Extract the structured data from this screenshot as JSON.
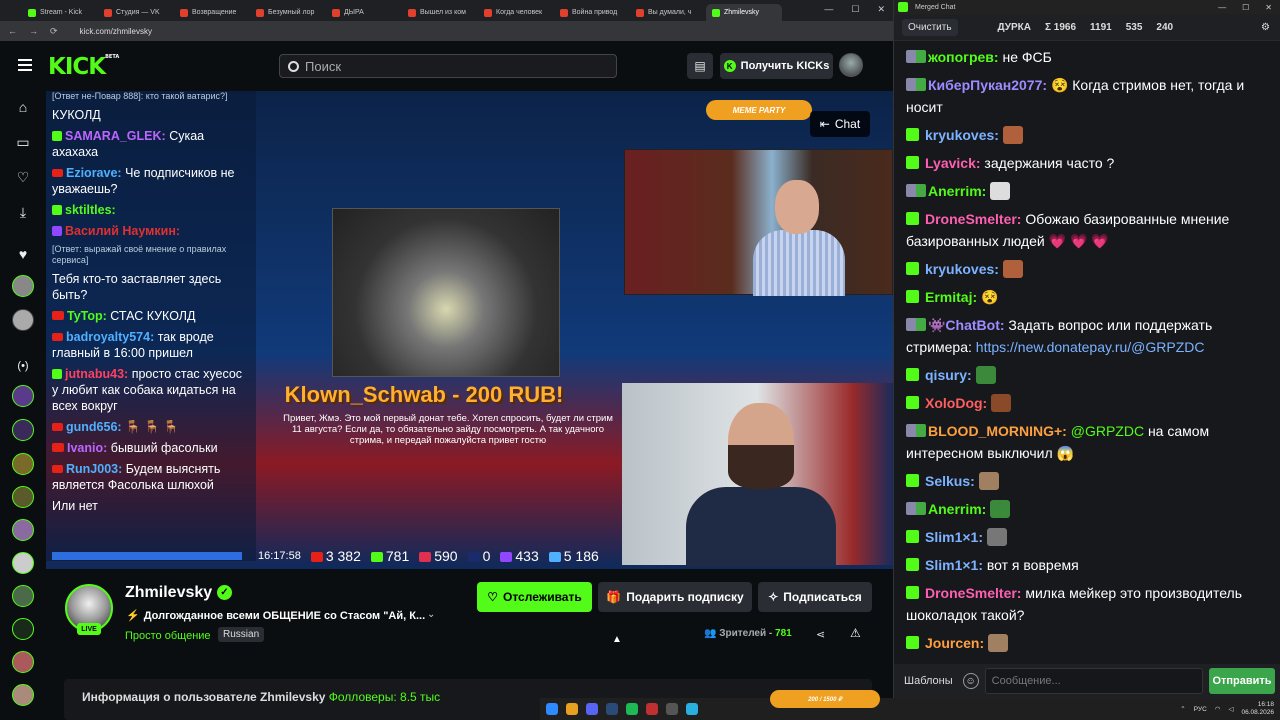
{
  "browser": {
    "tabs": [
      "Stream - Kick",
      "Студия — VK",
      "Возвращение",
      "Безумный лор",
      "ДЫРА",
      "Вышел из ком",
      "Когда человек",
      "Война привод",
      "Вы думали, ч",
      "Zhmilevsky"
    ],
    "url": "kick.com/zhmilevsky"
  },
  "header": {
    "logo": "KICK",
    "beta": "BETA",
    "search_placeholder": "Поиск",
    "kicks_button": "Получить KICKs"
  },
  "player": {
    "overlay_chat": [
      {
        "platform": "sub",
        "text": "[Ответ не-Повар 888]: кто такой ватарис?]"
      },
      {
        "platform": "none",
        "name": "",
        "text": "КУКОЛД"
      },
      {
        "platform": "kick",
        "name": "SAMARA_GLEK:",
        "text": "Сукаа ахахаха",
        "color": "#bb66ff"
      },
      {
        "platform": "yt",
        "name": "Eziorave:",
        "text": "Че подписчиков не уважаешь?",
        "color": "#4fb0ff"
      },
      {
        "platform": "kick",
        "name": "sktiltles:",
        "text": "",
        "color": "#53fc18"
      },
      {
        "platform": "tw",
        "name": "Василий Наумкин:",
        "text": "",
        "color": "#e03030"
      },
      {
        "platform": "sub",
        "text": "[Ответ: выражай своё мнение о правилах сервиса]"
      },
      {
        "platform": "none",
        "name": "",
        "text": "Тебя кто-то заставляет здесь быть?"
      },
      {
        "platform": "live",
        "name": "TyTop:",
        "text": "СТАС КУКОЛД",
        "color": "#53fc18"
      },
      {
        "platform": "yt",
        "name": "badroyalty574:",
        "text": "так вроде главный в 16:00 пришел",
        "color": "#4fb0ff"
      },
      {
        "platform": "kick",
        "name": "jutnabu43:",
        "text": "просто стас хуесос у любит как собака кидаться на всех вокруг",
        "color": "#ff4060"
      },
      {
        "platform": "yt",
        "name": "gund656:",
        "text": "🪑 🪑 🪑",
        "color": "#4fb0ff"
      },
      {
        "platform": "live",
        "name": "Ivanio:",
        "text": "бывший фасольки",
        "color": "#bb66ff"
      },
      {
        "platform": "yt",
        "name": "RunJ003:",
        "text": "Будем выяснять является Фасолька шлюхой",
        "color": "#4fb0ff"
      },
      {
        "platform": "none",
        "name": "",
        "text": "Или нет"
      }
    ],
    "donation_title": "Klown_Schwab - 200 RUB!",
    "donation_text": "Привет, Жмэ. Это мой первый донат тебе. Хотел спросить, будет ли стрим 11 августа? Если да, то обязательно зайду посмотреть. А так удачного стрима, и передай пожалуйста привет гостю",
    "meme_party": "MEME PARTY",
    "chat_toggle": "Chat",
    "stats": {
      "time": "16:17:58",
      "youtube": "3 382",
      "kick": "781",
      "vklive": "590",
      "rutube": "0",
      "twitch": "433",
      "total": "5 186"
    }
  },
  "channel": {
    "name": "Zhmilevsky",
    "live": "LIVE",
    "title": "Долгожданное всеми ОБЩЕНИЕ со Стасом \"Ай, К...",
    "category": "Просто общение",
    "language": "Russian",
    "follow": "Отслеживать",
    "gift": "Подарить подписку",
    "subscribe": "Подписаться",
    "viewers_label": "Зрителей -",
    "viewers_count": "781",
    "about_label": "Информация о пользователе Zhmilevsky",
    "followers_label": "Фолловеры:",
    "followers_count": "8.5 тыс"
  },
  "chatwin": {
    "title": "Merged Chat",
    "clear": "Очистить",
    "stats": [
      "ДУРКА",
      "Σ 1966",
      "1191",
      "535",
      "240"
    ],
    "messages": [
      {
        "src": "both",
        "user": "жопогрев:",
        "text": "не ФСБ",
        "color": "#53fc18"
      },
      {
        "src": "both",
        "user": "КиберПукан2077:",
        "text": "😵 Когда стримов нет, тогда и носит",
        "color": "#9f8bff"
      },
      {
        "src": "kick",
        "user": "kryukoves:",
        "text": "",
        "emote": "#b0603a",
        "color": "#7cb2ff"
      },
      {
        "src": "kick",
        "user": "Lyavick:",
        "text": "задержания часто ?",
        "color": "#ff5fb0"
      },
      {
        "src": "both",
        "user": "Anerrim:",
        "text": "",
        "emote": "#ddd",
        "color": "#53fc18"
      },
      {
        "src": "kick",
        "user": "DroneSmelter:",
        "text": "Обожаю базированные мнение базированных людей 💗 💗 💗",
        "color": "#ff5fb0"
      },
      {
        "src": "kick",
        "user": "kryukoves:",
        "text": "",
        "emote": "#b0603a",
        "color": "#7cb2ff"
      },
      {
        "src": "kick",
        "user": "Ermitaj:",
        "text": "😵",
        "color": "#53fc18"
      },
      {
        "src": "both",
        "user": "👾ChatBot:",
        "text": "Задать вопрос или поддержать стримера: ",
        "link": "https://new.donatepay.ru/@GRPZDC",
        "color": "#9f8bff"
      },
      {
        "src": "kick",
        "user": "qisury:",
        "text": "",
        "emote": "#3b8a3b",
        "color": "#7cb2ff"
      },
      {
        "src": "kick",
        "user": "XoloDog:",
        "text": "",
        "emote": "#8a4a2a",
        "color": "#ff5f5f"
      },
      {
        "src": "both",
        "user": "BLOOD_MORNING+:",
        "mention": "@GRPZDC",
        "text": " на самом интересном  выключил 😱",
        "color": "#ffa040"
      },
      {
        "src": "kick",
        "user": "Selkus:",
        "text": "",
        "emote": "#a08060",
        "color": "#7cb2ff"
      },
      {
        "src": "both",
        "user": "Anerrim:",
        "text": "",
        "emote": "#3b8a3b",
        "color": "#53fc18"
      },
      {
        "src": "kick",
        "user": "Slim1×1:",
        "text": "",
        "emote": "#777",
        "color": "#7cb2ff"
      },
      {
        "src": "kick",
        "user": "Slim1×1:",
        "text": "вот я вовремя",
        "color": "#7cb2ff"
      },
      {
        "src": "kick",
        "user": "DroneSmelter:",
        "text": "милка мейкер это производитель шоколадок такой?",
        "color": "#ff5fb0"
      },
      {
        "src": "kick",
        "user": "Jourcen:",
        "text": "",
        "emote": "#a08060",
        "color": "#ffa040"
      }
    ],
    "templates": "Шаблоны",
    "input_placeholder": "Сообщение...",
    "send": "Отправить"
  },
  "taskbar": {
    "lang": "РУС",
    "time": "16:18",
    "date": "06.08.2026",
    "widget": "200 / 1500 ₽"
  },
  "colors": {
    "kick_green": "#53fc18",
    "bg": "#0b0e11"
  }
}
